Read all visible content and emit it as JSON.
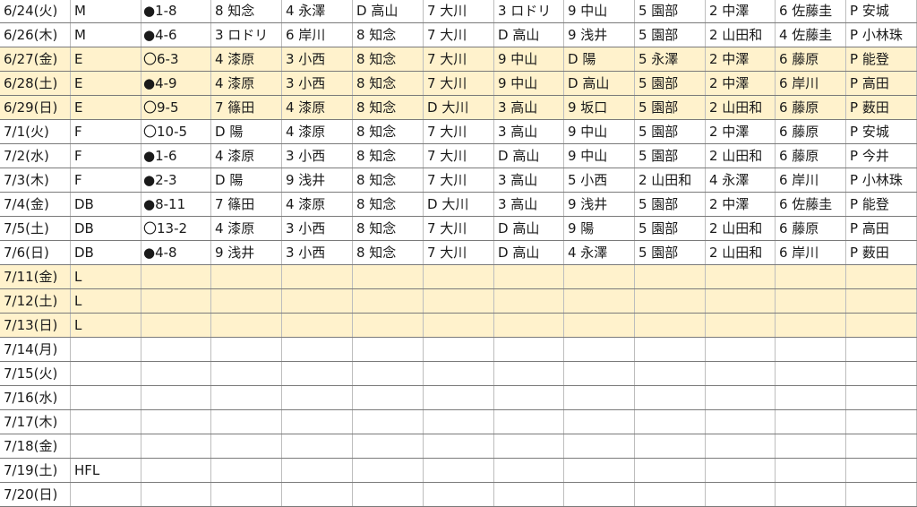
{
  "rows": [
    {
      "highlight": false,
      "cells": [
        "6/24(火)",
        "M",
        "●1-8",
        "8 知念",
        "4 永澤",
        "D 高山",
        "7 大川",
        "3 ロドリ",
        "9 中山",
        "5 園部",
        "2 中澤",
        "6 佐藤圭",
        "P 安城"
      ]
    },
    {
      "highlight": false,
      "cells": [
        "6/26(木)",
        "M",
        "●4-6",
        "3 ロドリ",
        "6 岸川",
        "8 知念",
        "7 大川",
        "D 高山",
        "9 浅井",
        "5 園部",
        "2 山田和",
        "4 佐藤圭",
        "P 小林珠"
      ]
    },
    {
      "highlight": true,
      "cells": [
        "6/27(金)",
        "E",
        "〇6-3",
        "4 漆原",
        "3 小西",
        "8 知念",
        "7 大川",
        "9 中山",
        "D 陽",
        "5 永澤",
        "2 中澤",
        "6 藤原",
        "P 能登"
      ]
    },
    {
      "highlight": true,
      "cells": [
        "6/28(土)",
        "E",
        "●4-9",
        "4 漆原",
        "3 小西",
        "8 知念",
        "7 大川",
        "9 中山",
        "D 高山",
        "5 園部",
        "2 中澤",
        "6 岸川",
        "P 高田"
      ]
    },
    {
      "highlight": true,
      "cells": [
        "6/29(日)",
        "E",
        "〇9-5",
        "7 篠田",
        "4 漆原",
        "8 知念",
        "D 大川",
        "3 高山",
        "9 坂口",
        "5 園部",
        "2 山田和",
        "6 藤原",
        "P 薮田"
      ]
    },
    {
      "highlight": false,
      "cells": [
        "7/1(火)",
        "F",
        "〇10-5",
        "D 陽",
        "4 漆原",
        "8 知念",
        "7 大川",
        "3 高山",
        "9 中山",
        "5 園部",
        "2 中澤",
        "6 藤原",
        "P 安城"
      ]
    },
    {
      "highlight": false,
      "cells": [
        "7/2(水)",
        "F",
        "●1-6",
        "4 漆原",
        "3 小西",
        "8 知念",
        "7 大川",
        "D 高山",
        "9 中山",
        "5 園部",
        "2 山田和",
        "6 藤原",
        "P 今井"
      ]
    },
    {
      "highlight": false,
      "cells": [
        "7/3(木)",
        "F",
        "●2-3",
        "D 陽",
        "9 浅井",
        "8 知念",
        "7 大川",
        "3 高山",
        "5 小西",
        "2 山田和",
        "4 永澤",
        "6 岸川",
        "P 小林珠"
      ]
    },
    {
      "highlight": false,
      "cells": [
        "7/4(金)",
        "DB",
        "●8-11",
        "7 篠田",
        "4 漆原",
        "8 知念",
        "D 大川",
        "3 高山",
        "9 浅井",
        "5 園部",
        "2 中澤",
        "6 佐藤圭",
        "P 能登"
      ]
    },
    {
      "highlight": false,
      "cells": [
        "7/5(土)",
        "DB",
        "〇13-2",
        "4 漆原",
        "3 小西",
        "8 知念",
        "7 大川",
        "D 高山",
        "9 陽",
        "5 園部",
        "2 山田和",
        "6 藤原",
        "P 高田"
      ]
    },
    {
      "highlight": false,
      "cells": [
        "7/6(日)",
        "DB",
        "●4-8",
        "9 浅井",
        "3 小西",
        "8 知念",
        "7 大川",
        "D 高山",
        "4 永澤",
        "5 園部",
        "2 山田和",
        "6 岸川",
        "P 薮田"
      ]
    },
    {
      "highlight": true,
      "cells": [
        "7/11(金)",
        "L",
        "",
        "",
        "",
        "",
        "",
        "",
        "",
        "",
        "",
        "",
        ""
      ]
    },
    {
      "highlight": true,
      "cells": [
        "7/12(土)",
        "L",
        "",
        "",
        "",
        "",
        "",
        "",
        "",
        "",
        "",
        "",
        ""
      ]
    },
    {
      "highlight": true,
      "cells": [
        "7/13(日)",
        "L",
        "",
        "",
        "",
        "",
        "",
        "",
        "",
        "",
        "",
        "",
        ""
      ]
    },
    {
      "highlight": false,
      "cells": [
        "7/14(月)",
        "",
        "",
        "",
        "",
        "",
        "",
        "",
        "",
        "",
        "",
        "",
        ""
      ]
    },
    {
      "highlight": false,
      "cells": [
        "7/15(火)",
        "",
        "",
        "",
        "",
        "",
        "",
        "",
        "",
        "",
        "",
        "",
        ""
      ]
    },
    {
      "highlight": false,
      "cells": [
        "7/16(水)",
        "",
        "",
        "",
        "",
        "",
        "",
        "",
        "",
        "",
        "",
        "",
        ""
      ]
    },
    {
      "highlight": false,
      "cells": [
        "7/17(木)",
        "",
        "",
        "",
        "",
        "",
        "",
        "",
        "",
        "",
        "",
        "",
        ""
      ]
    },
    {
      "highlight": false,
      "cells": [
        "7/18(金)",
        "",
        "",
        "",
        "",
        "",
        "",
        "",
        "",
        "",
        "",
        "",
        ""
      ]
    },
    {
      "highlight": false,
      "cells": [
        "7/19(土)",
        "HFL",
        "",
        "",
        "",
        "",
        "",
        "",
        "",
        "",
        "",
        "",
        ""
      ]
    },
    {
      "highlight": false,
      "cells": [
        "7/20(日)",
        "",
        "",
        "",
        "",
        "",
        "",
        "",
        "",
        "",
        "",
        "",
        ""
      ]
    }
  ],
  "colors": {
    "highlight": "#fff2cc",
    "gridline": "#7a7a7a",
    "column_line": "#bdbdbd"
  }
}
